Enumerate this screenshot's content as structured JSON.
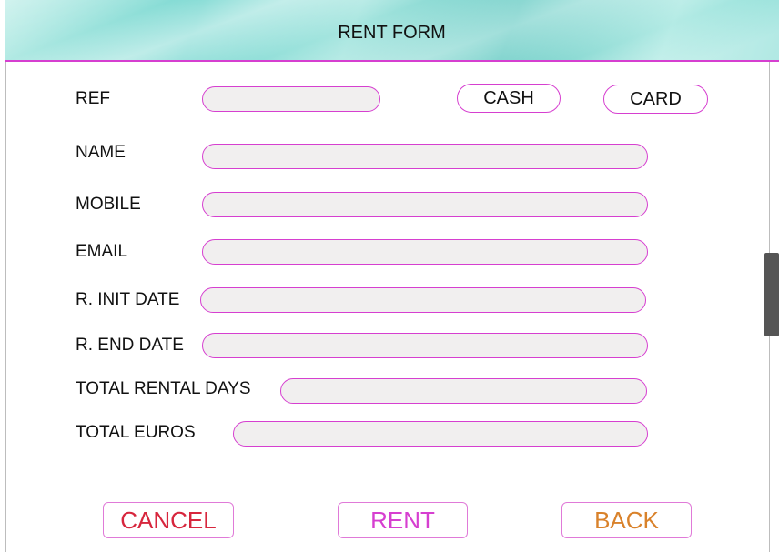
{
  "header": {
    "title": "RENT FORM"
  },
  "form": {
    "ref_label": "REF",
    "name_label": "NAME",
    "mobile_label": "MOBILE",
    "email_label": "EMAIL",
    "init_date_label": "R. INIT DATE",
    "end_date_label": "R. END DATE",
    "total_days_label": "TOTAL RENTAL DAYS",
    "total_euros_label": "TOTAL EUROS",
    "ref_value": "",
    "name_value": "",
    "mobile_value": "",
    "email_value": "",
    "init_date_value": "",
    "end_date_value": "",
    "total_days_value": "",
    "total_euros_value": ""
  },
  "payment": {
    "cash_label": "CASH",
    "card_label": "CARD"
  },
  "actions": {
    "cancel_label": "CANCEL",
    "rent_label": "RENT",
    "back_label": "BACK"
  },
  "colors": {
    "accent_border": "#d63fd0",
    "cancel": "#d7263d",
    "rent": "#d63fd0",
    "back": "#d9822b",
    "field_fill": "#f1efef"
  }
}
